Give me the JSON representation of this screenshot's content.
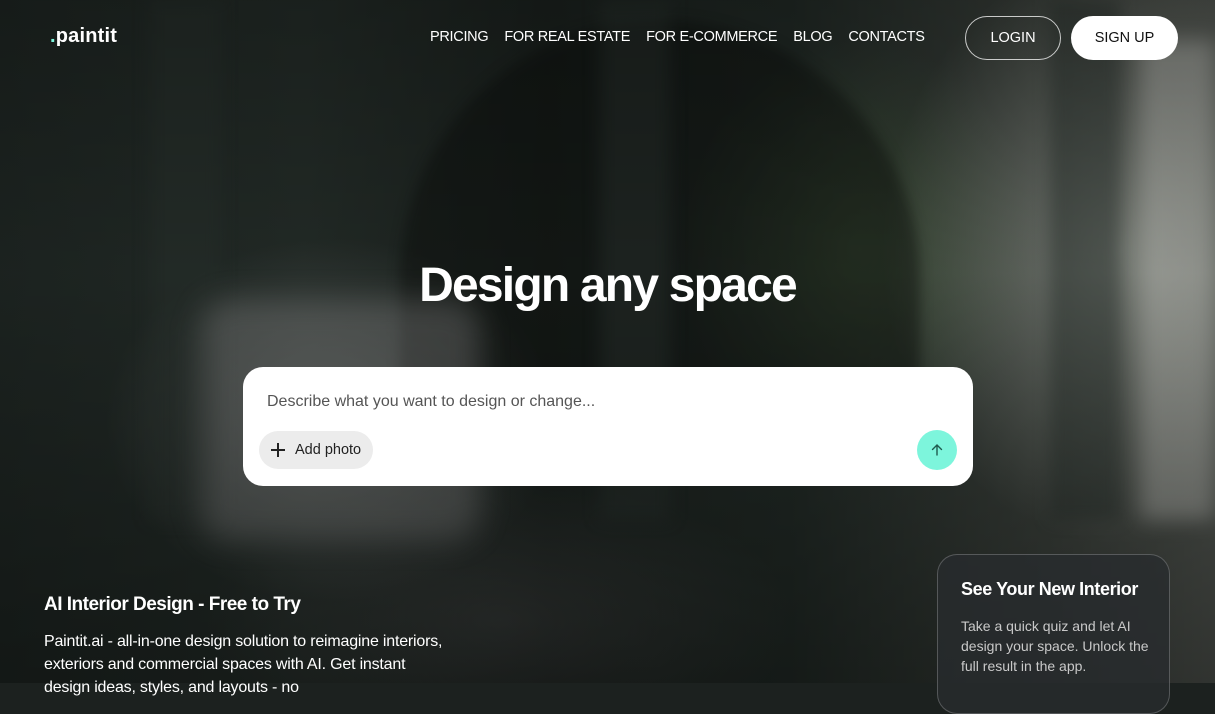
{
  "brand": {
    "logo_dot": ".",
    "logo_text": "paintit",
    "accent": "#7df5dc"
  },
  "nav": {
    "items": [
      "PRICING",
      "FOR REAL ESTATE",
      "FOR E-COMMERCE",
      "BLOG",
      "CONTACTS"
    ]
  },
  "auth": {
    "login_label": "LOGIN",
    "signup_label": "SIGN UP"
  },
  "hero": {
    "title": "Design any space",
    "prompt_placeholder": "Describe what you want to design or change...",
    "add_photo_label": "Add photo"
  },
  "intro": {
    "heading": "AI Interior Design - Free to Try",
    "body": "Paintit.ai - all-in-one design solution to reimagine interiors, exteriors and commercial spaces with AI. Get instant design ideas, styles, and layouts - no"
  },
  "quiz_card": {
    "title": "See Your New Interior",
    "body": "Take a quick quiz and let AI design your space. Unlock the full result in the app."
  }
}
